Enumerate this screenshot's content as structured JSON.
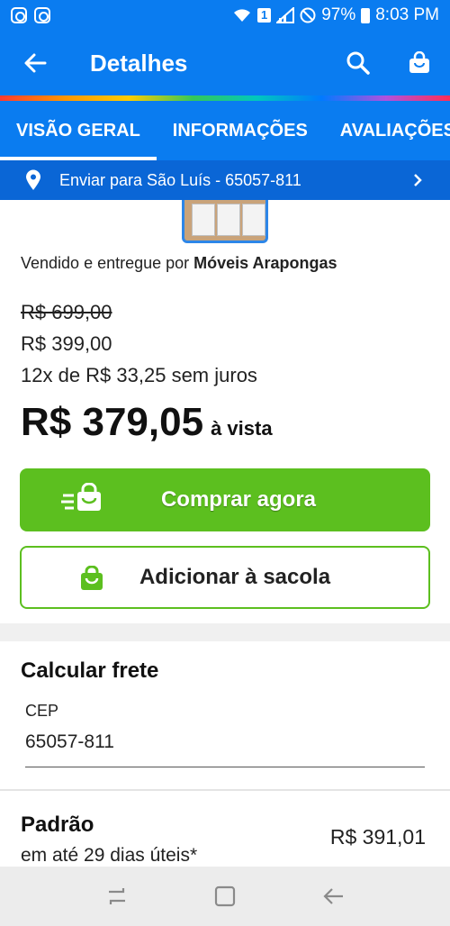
{
  "status_bar": {
    "battery": "97%",
    "time": "8:03 PM",
    "sim": "1",
    "icons": [
      "instagram-icon",
      "instagram-icon",
      "wifi-icon",
      "signal-icon",
      "dnd-icon",
      "battery-icon"
    ]
  },
  "app_bar": {
    "title": "Detalhes",
    "icons": [
      "back-arrow-icon",
      "search-icon",
      "shopping-bag-icon"
    ]
  },
  "tabs": [
    {
      "label": "VISÃO GERAL",
      "active": true
    },
    {
      "label": "INFORMAÇÕES",
      "active": false
    },
    {
      "label": "AVALIAÇÕES",
      "active": false
    }
  ],
  "shipping_bar": {
    "text": "Enviar para São Luís - 65057-811",
    "icons": [
      "location-pin-icon",
      "chevron-right-icon"
    ]
  },
  "product": {
    "seller_prefix": "Vendido e entregue por",
    "seller_name": "Móveis Arapongas",
    "old_price": "R$ 699,00",
    "price": "R$ 399,00",
    "installments": "12x de R$ 33,25 sem juros",
    "cash_price": "R$ 379,05",
    "cash_suffix": "à vista"
  },
  "buttons": {
    "buy_now": "Comprar agora",
    "add_to_bag": "Adicionar à sacola"
  },
  "freight": {
    "title": "Calcular frete",
    "cep_label": "CEP",
    "cep_value": "65057-811"
  },
  "shipping_option": {
    "name": "Padrão",
    "time": "em até 29 dias úteis*",
    "price": "R$ 391,01"
  },
  "colors": {
    "primary": "#0a7cf0",
    "buy_green": "#5cbf1f"
  }
}
